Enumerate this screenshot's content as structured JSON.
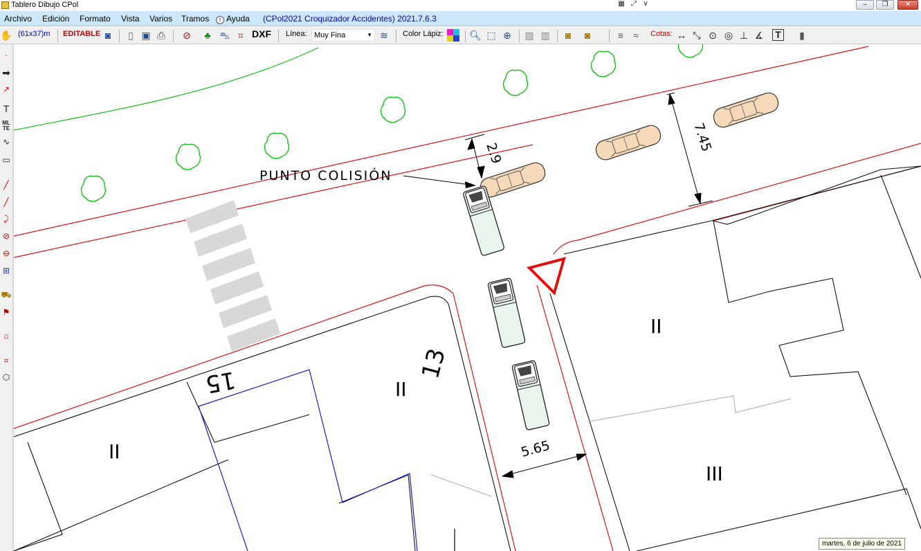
{
  "window": {
    "title": "Tablero Dibujo CPol"
  },
  "menu": {
    "items": [
      "Archivo",
      "Edición",
      "Formato",
      "Vista",
      "Varios",
      "Tramos",
      "Ayuda"
    ],
    "version": "(CPol2021 Croquizador Accidentes) 2021.7.6.3"
  },
  "toolbar": {
    "scale": "(61x37)m",
    "mode": "EDITABLE",
    "dxf_label": "DXF",
    "line_label": "Línea:",
    "line_value": "Muy Fina",
    "pencil_color_label": "Color Lápiz:",
    "cotas_label": "Cotas:"
  },
  "drawing": {
    "annotation": "PUNTO COLISIÓN",
    "dimensions": [
      "2.9",
      "7.45",
      "5.65"
    ],
    "lane_marks": [
      "II",
      "II",
      "III",
      "II"
    ],
    "street_numbers": [
      "13",
      "15"
    ],
    "colors": {
      "road_edge": "#e01010",
      "vegetation": "#10c010",
      "plot_outline": "#1a1acc",
      "yield_sign": "#e01010",
      "car_parked": "#f6d9b8",
      "van": "#e8f4ec"
    },
    "vehicles": {
      "parked_cars": 3,
      "vans": 3
    },
    "trees": 7,
    "crosswalk_stripes": 6
  },
  "status": {
    "date": "martes, 6 de julio de 2021"
  }
}
